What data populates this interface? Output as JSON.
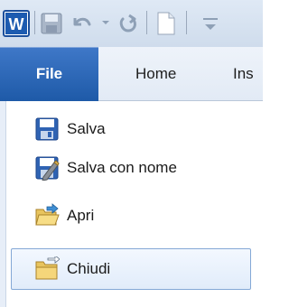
{
  "quick_access_toolbar": {
    "app_icon": "word-icon",
    "save_icon": "save-icon",
    "undo_icon": "undo-icon",
    "redo_icon": "redo-icon",
    "new_icon": "new-document-icon",
    "customize_icon": "customize-toolbar-icon"
  },
  "tabs": {
    "file": "File",
    "home": "Home",
    "insert": "Ins"
  },
  "file_menu": {
    "items": [
      {
        "label": "Salva",
        "icon": "save-icon"
      },
      {
        "label": "Salva con nome",
        "icon": "save-as-icon"
      },
      {
        "label": "Apri",
        "icon": "open-folder-icon"
      },
      {
        "label": "Chiudi",
        "icon": "close-folder-icon",
        "state": "hovered"
      }
    ]
  },
  "colors": {
    "file_tab": "#2a64b4",
    "toolbar_bg": "#d6e2f0",
    "hover_border": "#84a8d6",
    "hover_bg": "#e8f1fc"
  }
}
